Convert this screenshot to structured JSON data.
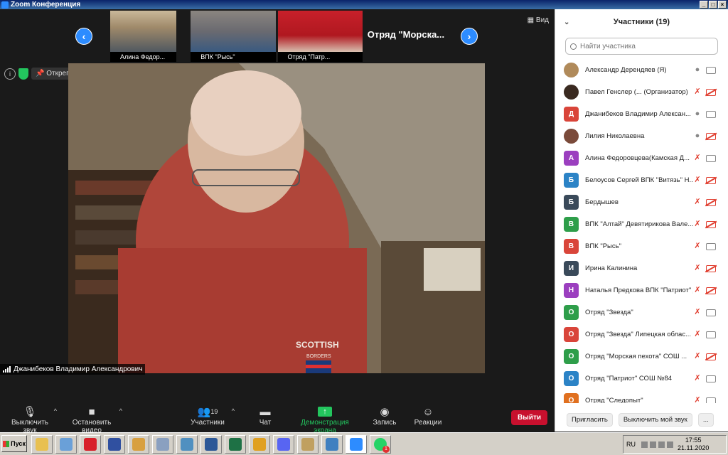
{
  "window": {
    "title": "Zoom Конференция"
  },
  "filmstrip": {
    "thumbnails": [
      {
        "name": "Алина Федор..."
      },
      {
        "name": "ВПК \"Рысь\""
      },
      {
        "name": "Отряд \"Патр..."
      }
    ],
    "name_tile": "Отряд  \"Морска...",
    "view_label": "Вид"
  },
  "top_controls": {
    "unpin_label": "Открепить видео"
  },
  "main_video": {
    "speaker_name": "Джанибеков Владимир Александрович",
    "sweater_text": "SCOTTISH",
    "sweater_sub": "BORDERS"
  },
  "toolbar": {
    "mute_label": "Выключить звук",
    "video_label": "Остановить видео",
    "participants_label": "Участники",
    "participants_count": "19",
    "chat_label": "Чат",
    "share_label": "Демонстрация экрана",
    "record_label": "Запись",
    "reactions_label": "Реакции",
    "exit_label": "Выйти"
  },
  "panel": {
    "title": "Участники (19)",
    "search_placeholder": "Найти участника",
    "participants": [
      {
        "name": "Александр Дерендяев (Я)",
        "avatar_letter": "",
        "avatar_color": "#b08a5a",
        "mic_muted": false,
        "cam_off": false
      },
      {
        "name": "Павел Генслер (...   (Организатор)",
        "avatar_letter": "",
        "avatar_color": "#3a2a20",
        "mic_muted": true,
        "cam_off": true
      },
      {
        "name": "Джанибеков Владимир Алексан...",
        "avatar_letter": "Д",
        "avatar_color": "#d9453a",
        "mic_muted": false,
        "cam_off": false
      },
      {
        "name": "Лилия Николаевна",
        "avatar_letter": "",
        "avatar_color": "#7a4a3a",
        "mic_muted": false,
        "cam_off": true
      },
      {
        "name": "Алина Федоровцева(Камская Д...",
        "avatar_letter": "А",
        "avatar_color": "#9b3fbf",
        "mic_muted": true,
        "cam_off": false
      },
      {
        "name": "Белоусов Сергей ВПК \"Витязь\" Н...",
        "avatar_letter": "Б",
        "avatar_color": "#2b83c6",
        "mic_muted": true,
        "cam_off": true
      },
      {
        "name": "Бердышев",
        "avatar_letter": "Б",
        "avatar_color": "#3a4a5a",
        "mic_muted": true,
        "cam_off": true
      },
      {
        "name": "ВПК \"Алтай\" Девятирикова Вале...",
        "avatar_letter": "В",
        "avatar_color": "#2e9e4a",
        "mic_muted": true,
        "cam_off": true
      },
      {
        "name": "ВПК \"Рысь\"",
        "avatar_letter": "В",
        "avatar_color": "#d9453a",
        "mic_muted": true,
        "cam_off": false
      },
      {
        "name": "Ирина Калинина",
        "avatar_letter": "И",
        "avatar_color": "#3a4a5a",
        "mic_muted": true,
        "cam_off": true
      },
      {
        "name": "Наталья Предкова ВПК \"Патриот\" Д...",
        "avatar_letter": "Н",
        "avatar_color": "#9b3fbf",
        "mic_muted": true,
        "cam_off": true
      },
      {
        "name": "Отряд \"Звезда\"",
        "avatar_letter": "О",
        "avatar_color": "#2e9e4a",
        "mic_muted": true,
        "cam_off": false
      },
      {
        "name": "Отряд \"Звезда\" Липецкая облас...",
        "avatar_letter": "О",
        "avatar_color": "#d9453a",
        "mic_muted": true,
        "cam_off": false
      },
      {
        "name": "Отряд \"Морская пехота\" СОШ ...",
        "avatar_letter": "О",
        "avatar_color": "#2e9e4a",
        "mic_muted": true,
        "cam_off": true
      },
      {
        "name": "Отряд \"Патриот\" СОШ №84",
        "avatar_letter": "О",
        "avatar_color": "#2b83c6",
        "mic_muted": true,
        "cam_off": false
      },
      {
        "name": "Отряд \"Следопыт\"",
        "avatar_letter": "О",
        "avatar_color": "#e07020",
        "mic_muted": true,
        "cam_off": false
      }
    ],
    "invite_label": "Пригласить",
    "mute_me_label": "Выключить мой звук",
    "more_label": "..."
  },
  "taskbar": {
    "start_label": "Пуск",
    "lang": "RU",
    "time": "17:55",
    "date": "21.11.2020",
    "badge": "1",
    "apps": [
      {
        "icon": "folder-icon",
        "color": "#e8c050"
      },
      {
        "icon": "mail-icon",
        "color": "#6aa0d8"
      },
      {
        "icon": "opera-icon",
        "color": "#d8202a"
      },
      {
        "icon": "save-icon",
        "color": "#3050a0"
      },
      {
        "icon": "paint-icon",
        "color": "#d8a040"
      },
      {
        "icon": "calculator-icon",
        "color": "#8aa0c0"
      },
      {
        "icon": "disk-icon",
        "color": "#5090c0"
      },
      {
        "icon": "word-icon",
        "color": "#2b5797"
      },
      {
        "icon": "excel-icon",
        "color": "#1e7145"
      },
      {
        "icon": "chrome-icon",
        "color": "#e0a020"
      },
      {
        "icon": "discord-icon",
        "color": "#5865f2"
      },
      {
        "icon": "photo-icon",
        "color": "#c0a060"
      },
      {
        "icon": "network-icon",
        "color": "#4080c0"
      },
      {
        "icon": "zoom-icon",
        "color": "#2d8cff"
      },
      {
        "icon": "whatsapp-icon",
        "color": "#25d366"
      }
    ]
  }
}
